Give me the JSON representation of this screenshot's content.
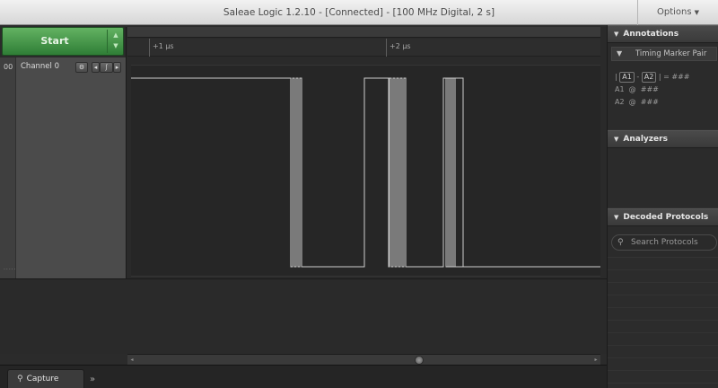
{
  "window": {
    "title": "Saleae Logic 1.2.10 - [Connected] - [100 MHz Digital, 2 s]",
    "options_label": "Options"
  },
  "capture": {
    "start_label": "Start"
  },
  "channel": {
    "index": "00",
    "name": "Channel 0"
  },
  "ruler": {
    "tick_labels": [
      "+1 µs",
      "+2 µs"
    ]
  },
  "signal": {
    "x_domain": [
      0,
      523
    ],
    "high_segments": [
      [
        0,
        178
      ],
      [
        260,
        287
      ],
      [
        348,
        370
      ]
    ],
    "pulse_groups": [
      {
        "start": 180,
        "count": 3,
        "pitch": 4
      },
      {
        "start": 288,
        "count": 5,
        "pitch": 4
      },
      {
        "start": 351,
        "count": 3,
        "pitch": 4
      }
    ]
  },
  "colors": {
    "trace": "#cfcfcf",
    "start_button": "#4a9a4c",
    "panel_header": "#424242"
  },
  "icons": {
    "gear": "gear-icon",
    "search": "search-icon",
    "pin": "pin-icon"
  },
  "panel": {
    "annotations": {
      "title": "Annotations",
      "timing_marker": "Timing Marker Pair",
      "a1": "A1",
      "a2": "A2",
      "dash": "-",
      "equals": "= ###",
      "a1_row": "A1  @  ###",
      "a2_row": "A2  @  ###"
    },
    "analyzers": {
      "title": "Analyzers"
    },
    "decoded": {
      "title": "Decoded Protocols",
      "search_placeholder": "Search Protocols"
    }
  },
  "bottom": {
    "capture_tab": "Capture",
    "more_tab": "»"
  }
}
